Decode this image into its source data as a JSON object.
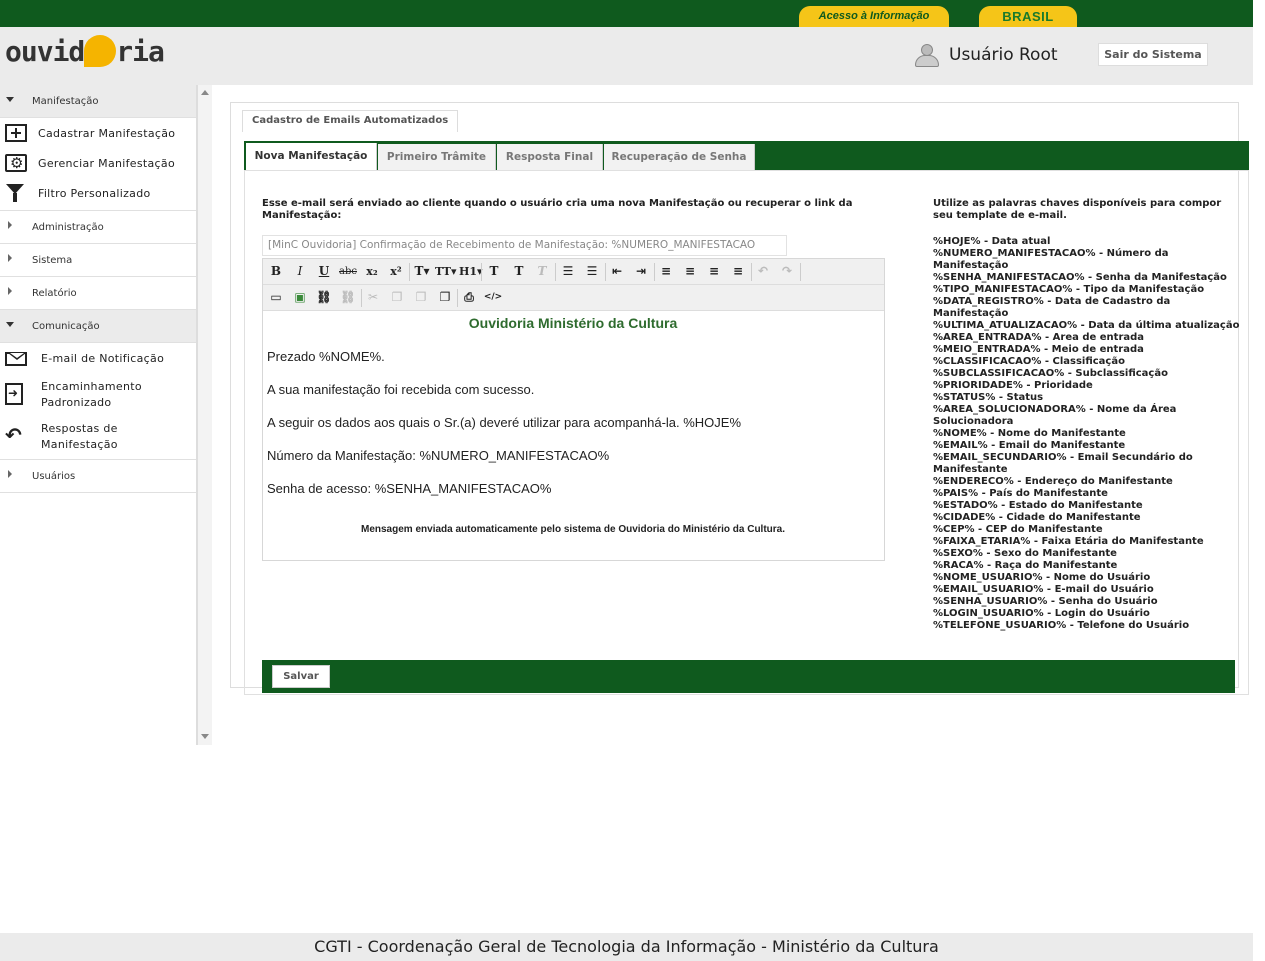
{
  "topbar": {
    "acesso_label": "Acesso à Informação",
    "brasil_label": "BRASIL"
  },
  "header": {
    "logo_pre": "ouvid",
    "logo_post": "ria",
    "user_name": "Usuário Root",
    "logout_label": "Sair do Sistema"
  },
  "sidebar": {
    "manifestacao": {
      "label": "Manifestação",
      "items": [
        "Cadastrar Manifestação",
        "Gerenciar Manifestação",
        "Filtro Personalizado"
      ]
    },
    "administracao": "Administração",
    "sistema": "Sistema",
    "relatorio": "Relatório",
    "comunicacao": {
      "label": "Comunicação",
      "items": [
        "E-mail de Notificação",
        "Encaminhamento Padronizado",
        "Respostas de Manifestação"
      ]
    },
    "usuarios": "Usuários"
  },
  "panel": {
    "legend": "Cadastro de Emails Automatizados",
    "tabs": [
      "Nova Manifestação",
      "Primeiro Trâmite",
      "Resposta Final",
      "Recuperação de Senha"
    ],
    "intro": "Esse e-mail será enviado ao cliente quando o usuário cria uma nova Manifestação ou recuperar o link da Manifestação:",
    "subject_value": "[MinC Ouvidoria] Confirmação de Recebimento de Manifestação: %NUMERO_MANIFESTACAO",
    "editor": {
      "title": "Ouvidoria Ministério da Cultura",
      "lines": [
        "Prezado %NOME%.",
        "A sua manifestação foi recebida com sucesso.",
        "A seguir os dados aos quais o Sr.(a) deveré utilizar para acompanhá-la. %HOJE%",
        "Número da Manifestação: %NUMERO_MANIFESTACAO%",
        "Senha de acesso: %SENHA_MANIFESTACAO%"
      ],
      "footer_note": "Mensagem enviada automaticamente pelo sistema de Ouvidoria do Ministério da Cultura."
    },
    "keywords_hint": "Utilize as palavras chaves disponíveis para compor seu template de e-mail.",
    "keywords": [
      "%HOJE% - Data atual",
      "%NUMERO_MANIFESTACAO% - Número da Manifestação",
      "%SENHA_MANIFESTACAO% - Senha da Manifestação",
      "%TIPO_MANIFESTACAO% - Tipo da Manifestação",
      "%DATA_REGISTRO% - Data de Cadastro da Manifestação",
      "%ULTIMA_ATUALIZACAO% - Data da última atualização",
      "%AREA_ENTRADA% - Area de entrada",
      "%MEIO_ENTRADA% - Meio de entrada",
      "%CLASSIFICACAO% - Classificação",
      "%SUBCLASSIFICACAO% - Subclassificação",
      "%PRIORIDADE% - Prioridade",
      "%STATUS% - Status",
      "%AREA_SOLUCIONADORA% - Nome da Área Solucionadora",
      "%NOME% - Nome do Manifestante",
      "%EMAIL% - Email do Manifestante",
      "%EMAIL_SECUNDARIO% - Email Secundário do Manifestante",
      "%ENDERECO% - Endereço do Manifestante",
      "%PAIS% - País do Manifestante",
      "%ESTADO% - Estado do Manifestante",
      "%CIDADE% - Cidade do Manifestante",
      "%CEP% - CEP do Manifestante",
      "%FAIXA_ETARIA% - Faixa Etária do Manifestante",
      "%SEXO% - Sexo do Manifestante",
      "%RACA% - Raça do Manifestante",
      "%NOME_USUARIO% - Nome do Usuário",
      "%EMAIL_USUARIO% - E-mail do Usuário",
      "%SENHA_USUARIO% - Senha do Usuário",
      "%LOGIN_USUARIO% - Login do Usuário",
      "%TELEFONE_USUARIO% - Telefone do Usuário"
    ],
    "save_label": "Salvar"
  },
  "footer": "CGTI - Coordenação Geral de Tecnologia da Informação - Ministério da Cultura",
  "colors": {
    "primary_green": "#0f5a1e",
    "accent_yellow": "#f5c518"
  }
}
